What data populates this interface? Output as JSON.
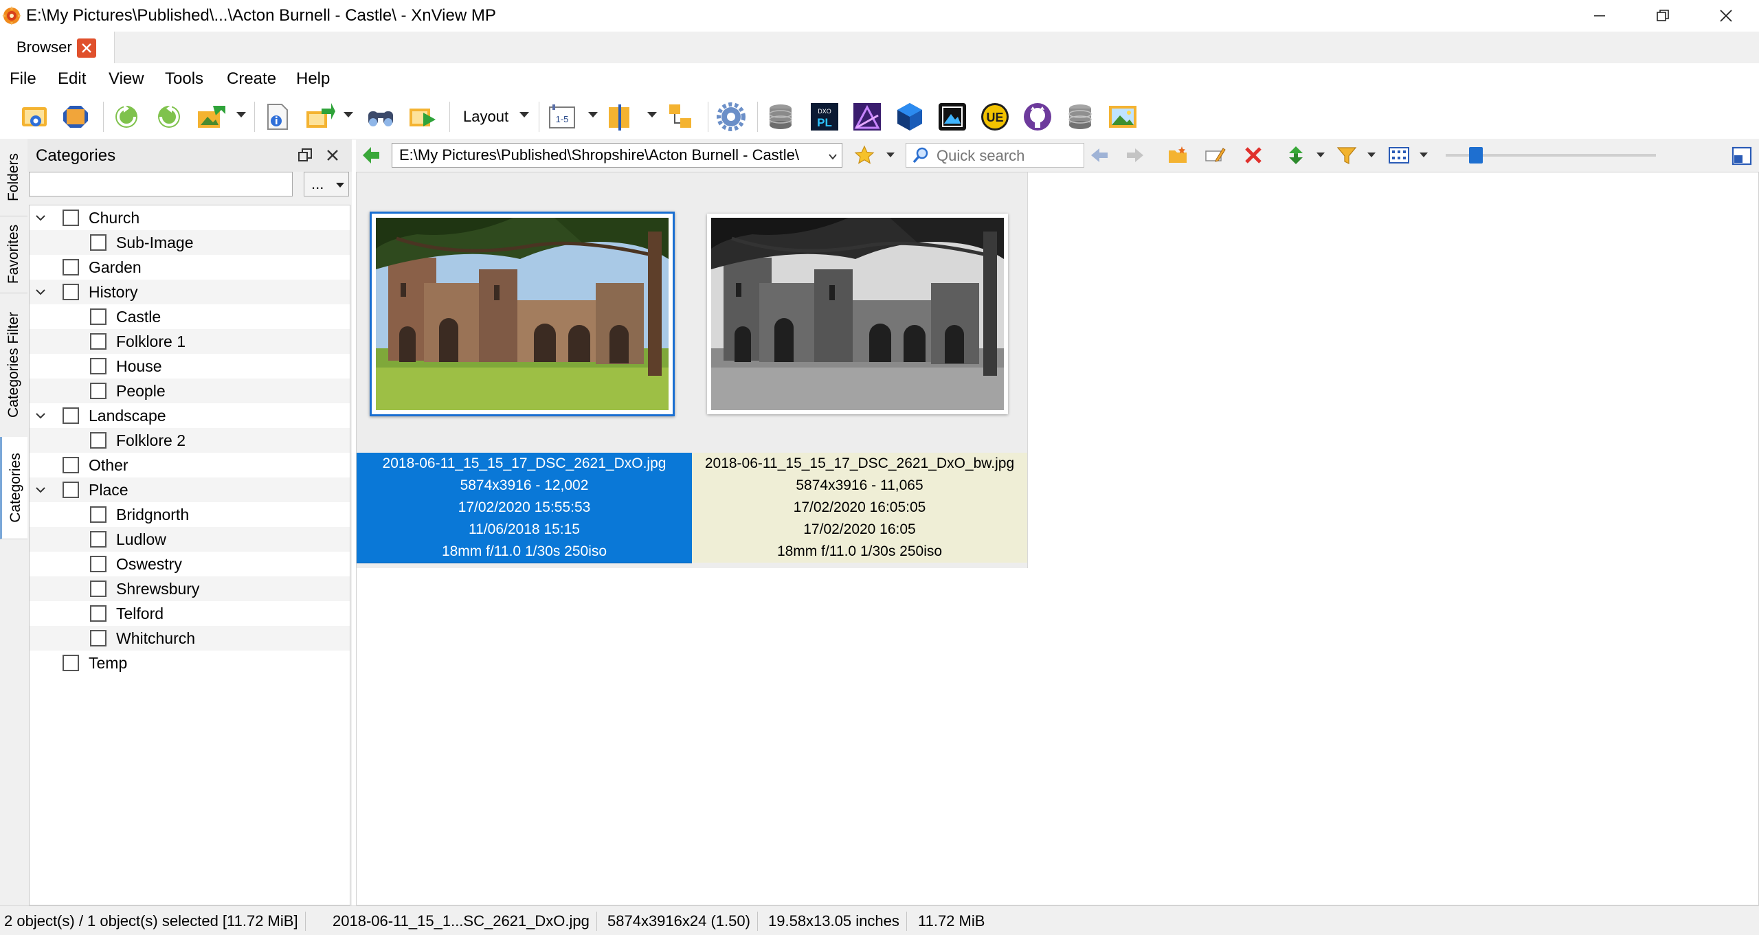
{
  "window": {
    "title": "E:\\My Pictures\\Published\\...\\Acton Burnell - Castle\\ - XnView MP"
  },
  "tabs": [
    {
      "label": "Browser"
    }
  ],
  "menu": [
    "File",
    "Edit",
    "View",
    "Tools",
    "Create",
    "Help"
  ],
  "toolbar": {
    "layout_label": "Layout",
    "icons": [
      "open-browser-icon",
      "fullscreen-icon",
      "rotate-left-icon",
      "rotate-right-icon",
      "convert-icon",
      "properties-icon",
      "export-icon",
      "find-icon",
      "slideshow-icon",
      "batch-rename-icon",
      "compare-icon",
      "sort-icon",
      "settings-icon",
      "database-icon",
      "dxo-photolab-icon",
      "affinity-photo-icon",
      "app-cube-icon",
      "photo-app-icon",
      "ultraedit-icon",
      "github-icon",
      "database-2-icon",
      "gallery-icon"
    ]
  },
  "side_tabs": [
    "Folders",
    "Favorites",
    "Categories Filter",
    "Categories"
  ],
  "categories_panel": {
    "title": "Categories",
    "filter_value": "",
    "more_label": "...",
    "items": [
      {
        "label": "Church",
        "level": 0,
        "expanded": true,
        "checked": false
      },
      {
        "label": "Sub-Image",
        "level": 1,
        "checked": false
      },
      {
        "label": "Garden",
        "level": 0,
        "checked": false
      },
      {
        "label": "History",
        "level": 0,
        "expanded": true,
        "checked": false
      },
      {
        "label": "Castle",
        "level": 1,
        "checked": false
      },
      {
        "label": "Folklore 1",
        "level": 1,
        "checked": false
      },
      {
        "label": "House",
        "level": 1,
        "checked": false
      },
      {
        "label": "People",
        "level": 1,
        "checked": false
      },
      {
        "label": "Landscape",
        "level": 0,
        "expanded": true,
        "checked": false
      },
      {
        "label": "Folklore 2",
        "level": 1,
        "checked": false
      },
      {
        "label": "Other",
        "level": 0,
        "checked": false
      },
      {
        "label": "Place",
        "level": 0,
        "expanded": true,
        "checked": false
      },
      {
        "label": "Bridgnorth",
        "level": 1,
        "checked": false
      },
      {
        "label": "Ludlow",
        "level": 1,
        "checked": false
      },
      {
        "label": "Oswestry",
        "level": 1,
        "checked": false
      },
      {
        "label": "Shrewsbury",
        "level": 1,
        "checked": false
      },
      {
        "label": "Telford",
        "level": 1,
        "checked": false
      },
      {
        "label": "Whitchurch",
        "level": 1,
        "checked": false
      },
      {
        "label": "Temp",
        "level": 0,
        "checked": false
      }
    ]
  },
  "address_bar": {
    "path": "E:\\My Pictures\\Published\\Shropshire\\Acton Burnell - Castle\\",
    "search_placeholder": "Quick search",
    "zoom_fraction": 0.12
  },
  "files": [
    {
      "name": "2018-06-11_15_15_17_DSC_2621_DxO.jpg",
      "dims": "5874x3916 - 12,002",
      "modified": "17/02/2020 15:55:53",
      "taken": "11/06/2018 15:15",
      "exif": "18mm f/11.0 1/30s 250iso",
      "selected": true,
      "color": "color"
    },
    {
      "name": "2018-06-11_15_15_17_DSC_2621_DxO_bw.jpg",
      "dims": "5874x3916 - 11,065",
      "modified": "17/02/2020 16:05:05",
      "taken": "17/02/2020 16:05",
      "exif": "18mm f/11.0 1/30s 250iso",
      "selected": false,
      "color": "mono"
    }
  ],
  "status": {
    "selection": "2 object(s) / 1 object(s) selected [11.72 MiB]",
    "filename": "2018-06-11_15_1...SC_2621_DxO.jpg",
    "dimensions": "5874x3916x24 (1.50)",
    "print_size": "19.58x13.05 inches",
    "file_size": "11.72 MiB"
  },
  "colors": {
    "selection_blue": "#0a78d7",
    "info_bg": "#efeed6",
    "panel_bg": "#f0f0f0"
  }
}
